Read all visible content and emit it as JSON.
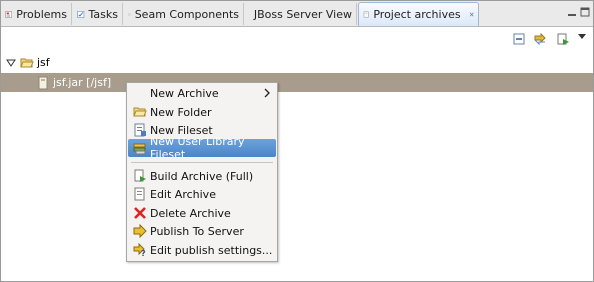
{
  "tabs": [
    {
      "label": "Problems",
      "icon": "problems-icon"
    },
    {
      "label": "Tasks",
      "icon": "tasks-icon"
    },
    {
      "label": "Seam Components",
      "icon": "seam-components-icon"
    },
    {
      "label": "JBoss Server View",
      "icon": "jboss-server-icon"
    },
    {
      "label": "Project archives",
      "icon": "project-archives-icon",
      "active": true
    }
  ],
  "toolbar": {
    "icons": [
      "collapse-all-icon",
      "link-editor-icon",
      "build-icon"
    ]
  },
  "tree": {
    "items": [
      {
        "label": "jsf",
        "icon": "folder-icon",
        "expanded": true
      },
      {
        "label": "jsf.jar [/jsf]",
        "icon": "jar-icon",
        "selected": true
      }
    ]
  },
  "context_menu": {
    "items": [
      {
        "label": "New Archive",
        "icon": "",
        "submenu": true
      },
      {
        "label": "New Folder",
        "icon": "folder-icon"
      },
      {
        "label": "New Fileset",
        "icon": "fileset-icon"
      },
      {
        "label": "New User Library Fileset",
        "icon": "user-library-icon",
        "highlighted": true
      },
      {
        "label": "Build Archive (Full)",
        "icon": "build-archive-icon"
      },
      {
        "label": "Edit Archive",
        "icon": "edit-archive-icon"
      },
      {
        "label": "Delete Archive",
        "icon": "delete-icon"
      },
      {
        "label": "Publish To Server",
        "icon": "publish-icon"
      },
      {
        "label": "Edit publish settings...",
        "icon": "publish-settings-icon"
      }
    ]
  },
  "colors": {
    "selection": "#a89c8c",
    "menu_highlight": "#4a85c8",
    "active_tab": "#dce8f8"
  }
}
